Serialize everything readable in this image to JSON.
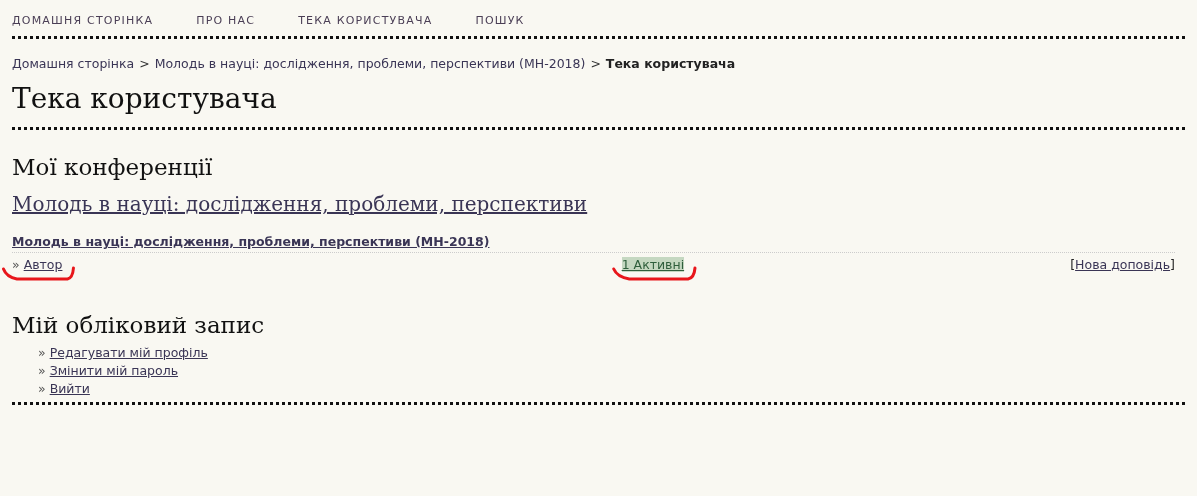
{
  "nav": [
    {
      "label": "ДОМАШНЯ СТОРІНКА"
    },
    {
      "label": "ПРО НАС"
    },
    {
      "label": "ТЕКА КОРИСТУВАЧА"
    },
    {
      "label": "ПОШУК"
    }
  ],
  "breadcrumb": [
    {
      "label": "Домашня сторінка",
      "current": false
    },
    {
      "label": "Молодь в науці: дослідження, проблеми, перспективи (МН-2018)",
      "current": false
    },
    {
      "label": "Тека користувача",
      "current": true
    }
  ],
  "breadcrumb_separator": ">",
  "page_title": "Тека користувача",
  "conferences": {
    "heading": "Мої конференції",
    "title": "Молодь в науці: дослідження, проблеми, перспективи",
    "schedule": {
      "title": "Молодь в науці: дослідження, проблеми, перспективи (МН-2018)",
      "bullet": "»",
      "role": "Автор",
      "active": {
        "label": "1 Активні",
        "highlighted": true
      },
      "new_paper": {
        "open": "[",
        "label": "Нова доповідь",
        "close": "]"
      }
    }
  },
  "account": {
    "heading": "Мій обліковий запис",
    "bullet": "»",
    "links": [
      {
        "label": "Редагувати мій профіль"
      },
      {
        "label": "Змінити мій пароль"
      },
      {
        "label": "Вийти"
      }
    ]
  }
}
